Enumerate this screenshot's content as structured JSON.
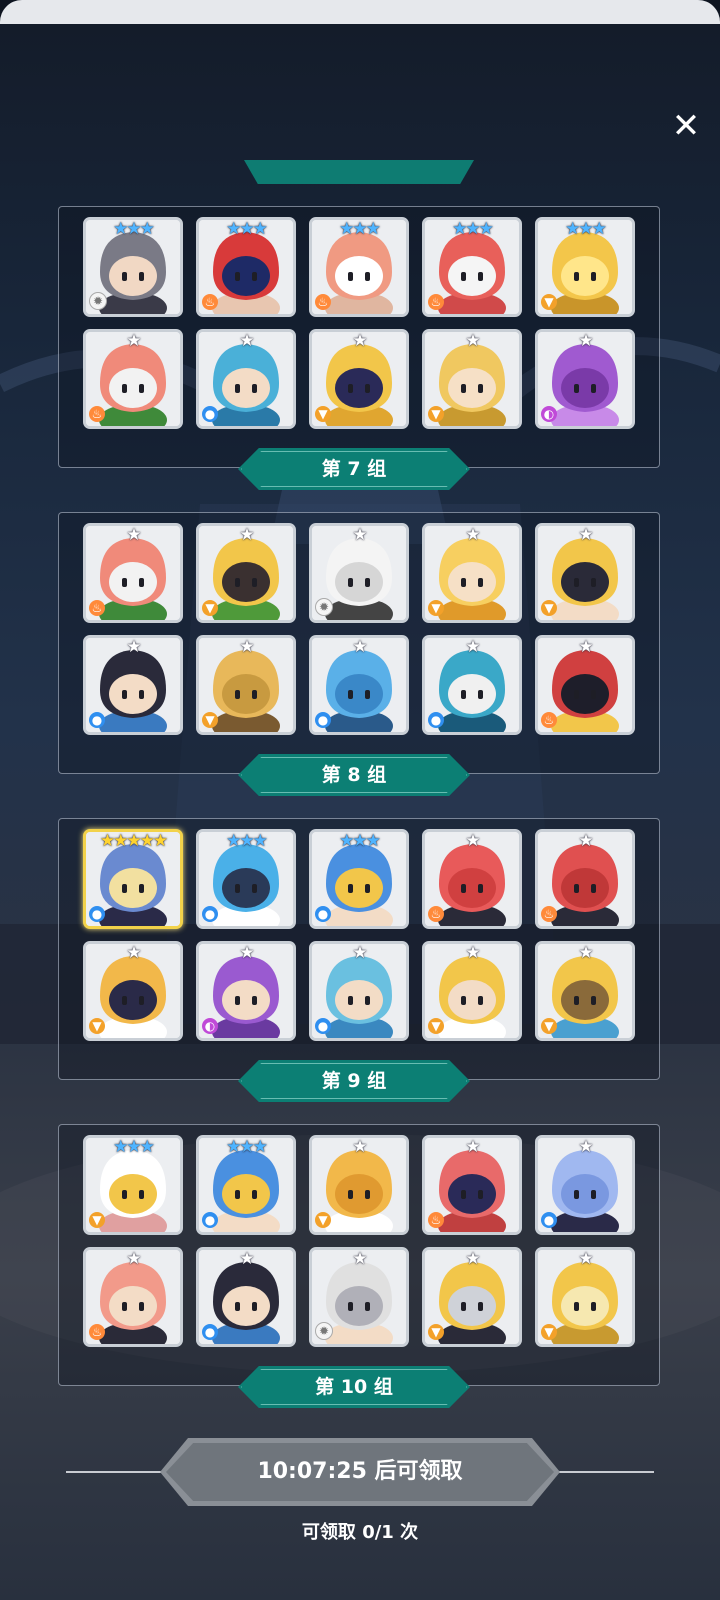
{
  "close_icon": "✕",
  "groups": [
    {
      "label": "第 7 组",
      "cards": [
        {
          "char": "horned-elf-hero",
          "stars": "★★★",
          "star_color": "blue",
          "element": "light",
          "palette": [
            "#7a7a86",
            "#f1d8c4",
            "#3a3a48"
          ]
        },
        {
          "char": "red-hood-rogue",
          "stars": "★★★",
          "star_color": "blue",
          "element": "fire",
          "palette": [
            "#d83a3a",
            "#1e2a66",
            "#e8c6b0"
          ]
        },
        {
          "char": "bearded-sage",
          "stars": "★★★",
          "star_color": "blue",
          "element": "fire",
          "palette": [
            "#f09a82",
            "#ffffff",
            "#e0b6a0"
          ]
        },
        {
          "char": "masked-jester",
          "stars": "★★★",
          "star_color": "blue",
          "element": "fire",
          "palette": [
            "#e8605a",
            "#f5f5f5",
            "#d04a4a"
          ]
        },
        {
          "char": "yellow-beast",
          "stars": "★★★",
          "star_color": "blue",
          "element": "earth",
          "palette": [
            "#f3c64a",
            "#ffe68a",
            "#c9952a"
          ]
        },
        {
          "char": "bandaged-pumpkin",
          "stars": "★",
          "star_color": "white",
          "element": "fire",
          "palette": [
            "#f08a7a",
            "#f2f2f2",
            "#3f8a3a"
          ]
        },
        {
          "char": "blue-hair-girl",
          "stars": "★",
          "star_color": "white",
          "element": "water",
          "palette": [
            "#4ab0d8",
            "#f3dcc6",
            "#2a7aa8"
          ]
        },
        {
          "char": "yellow-skull",
          "stars": "★",
          "star_color": "white",
          "element": "earth",
          "palette": [
            "#f2c64a",
            "#2a2a58",
            "#e0a630"
          ]
        },
        {
          "char": "golden-knight",
          "stars": "★",
          "star_color": "white",
          "element": "earth",
          "palette": [
            "#f0c860",
            "#f6e0c6",
            "#c89a30"
          ]
        },
        {
          "char": "purple-jelly",
          "stars": "★",
          "star_color": "white",
          "element": "dark",
          "palette": [
            "#a05ad0",
            "#7a3aa8",
            "#c88ae8"
          ]
        }
      ]
    },
    {
      "label": "第 8 组",
      "cards": [
        {
          "char": "bandaged-pumpkin",
          "stars": "★",
          "star_color": "white",
          "element": "fire",
          "palette": [
            "#f08a7a",
            "#f2f2f2",
            "#3f8a3a"
          ]
        },
        {
          "char": "sunflower-monster",
          "stars": "★",
          "star_color": "white",
          "element": "earth",
          "palette": [
            "#f2c64a",
            "#3a3030",
            "#4f9a3a"
          ]
        },
        {
          "char": "white-ghost",
          "stars": "★",
          "star_color": "white",
          "element": "light",
          "palette": [
            "#f4f4f4",
            "#d6d6d6",
            "#444444"
          ]
        },
        {
          "char": "fox-girl",
          "stars": "★",
          "star_color": "white",
          "element": "earth",
          "palette": [
            "#f7cf60",
            "#f6e0c6",
            "#e09a2a"
          ]
        },
        {
          "char": "pharaoh-boy",
          "stars": "★",
          "star_color": "white",
          "element": "earth",
          "palette": [
            "#f2c64a",
            "#2a2a38",
            "#f3dcc6"
          ]
        },
        {
          "char": "black-hair-girl",
          "stars": "★",
          "star_color": "white",
          "element": "water",
          "palette": [
            "#2a2a3a",
            "#f3dcc6",
            "#3a7ac0"
          ]
        },
        {
          "char": "stone-totem",
          "stars": "★",
          "star_color": "white",
          "element": "earth",
          "palette": [
            "#e8b85a",
            "#c89a40",
            "#7a5a30"
          ]
        },
        {
          "char": "blue-totem",
          "stars": "★",
          "star_color": "white",
          "element": "water",
          "palette": [
            "#5ab0e8",
            "#3a88c8",
            "#2a5a8a"
          ]
        },
        {
          "char": "horned-spirit",
          "stars": "★",
          "star_color": "white",
          "element": "water",
          "palette": [
            "#3aa8c8",
            "#f0f0f0",
            "#1a5a7a"
          ]
        },
        {
          "char": "red-chest",
          "stars": "★",
          "star_color": "white",
          "element": "fire",
          "palette": [
            "#d04040",
            "#1e1e2a",
            "#f2c64a"
          ]
        }
      ]
    },
    {
      "label": "第 9 组",
      "cards": [
        {
          "char": "blue-paladin",
          "stars": "★★★★★",
          "star_color": "gold",
          "element": "water",
          "gold": true,
          "palette": [
            "#6a8ad0",
            "#f2e0a0",
            "#2a2a48"
          ]
        },
        {
          "char": "blue-dragon",
          "stars": "★★★",
          "star_color": "blue",
          "element": "water",
          "palette": [
            "#4ab0e8",
            "#2a3a58",
            "#ffffff"
          ]
        },
        {
          "char": "crowned-prince",
          "stars": "★★★",
          "star_color": "blue",
          "element": "water",
          "palette": [
            "#4a90e0",
            "#f2c64a",
            "#f3dcc6"
          ]
        },
        {
          "char": "red-puffball",
          "stars": "★",
          "star_color": "white",
          "element": "fire",
          "palette": [
            "#e85a5a",
            "#d04040",
            "#2a2a38"
          ]
        },
        {
          "char": "red-cat-creature",
          "stars": "★",
          "star_color": "white",
          "element": "fire",
          "palette": [
            "#e05050",
            "#c03838",
            "#2a2a38"
          ]
        },
        {
          "char": "cat-mage",
          "stars": "★",
          "star_color": "white",
          "element": "earth",
          "palette": [
            "#f2b84a",
            "#2a2a48",
            "#ffffff"
          ]
        },
        {
          "char": "purple-witch",
          "stars": "★",
          "star_color": "white",
          "element": "dark",
          "palette": [
            "#9a5ad0",
            "#f3dcc6",
            "#6a3aa0"
          ]
        },
        {
          "char": "cat-ear-girl",
          "stars": "★",
          "star_color": "white",
          "element": "water",
          "palette": [
            "#6ac0e0",
            "#f3dcc6",
            "#3a88c0"
          ]
        },
        {
          "char": "winged-blonde",
          "stars": "★",
          "star_color": "white",
          "element": "earth",
          "palette": [
            "#f2c64a",
            "#f3dcc6",
            "#ffffff"
          ]
        },
        {
          "char": "golden-scepter",
          "stars": "★",
          "star_color": "white",
          "element": "earth",
          "palette": [
            "#f2c64a",
            "#8a6a3a",
            "#4aa0d0"
          ]
        }
      ]
    },
    {
      "label": "第 10 组",
      "cards": [
        {
          "char": "white-rabbit",
          "stars": "★★★",
          "star_color": "blue",
          "element": "earth",
          "palette": [
            "#ffffff",
            "#f2c64a",
            "#e0a0a0"
          ]
        },
        {
          "char": "crowned-prince",
          "stars": "★★★",
          "star_color": "blue",
          "element": "water",
          "palette": [
            "#4a90e0",
            "#f2c64a",
            "#f3dcc6"
          ]
        },
        {
          "char": "cactus",
          "stars": "★",
          "star_color": "white",
          "element": "earth",
          "palette": [
            "#f2b84a",
            "#e09a30",
            "#ffffff"
          ]
        },
        {
          "char": "skull-bandit",
          "stars": "★",
          "star_color": "white",
          "element": "fire",
          "palette": [
            "#e86a6a",
            "#2a2a58",
            "#c04040"
          ]
        },
        {
          "char": "blue-ghost",
          "stars": "★",
          "star_color": "white",
          "element": "water",
          "palette": [
            "#a0b8f0",
            "#7a98e0",
            "#2a2a48"
          ]
        },
        {
          "char": "pink-cat-girl",
          "stars": "★",
          "star_color": "white",
          "element": "fire",
          "palette": [
            "#f29a8a",
            "#f3dcc6",
            "#2a2a38"
          ]
        },
        {
          "char": "black-hair-girl",
          "stars": "★",
          "star_color": "white",
          "element": "water",
          "palette": [
            "#2a2a3a",
            "#f3dcc6",
            "#3a7ac0"
          ]
        },
        {
          "char": "silver-knight",
          "stars": "★",
          "star_color": "white",
          "element": "light",
          "palette": [
            "#e0e0e0",
            "#b0b0b8",
            "#f3dcc6"
          ]
        },
        {
          "char": "masked-angel",
          "stars": "★",
          "star_color": "white",
          "element": "earth",
          "palette": [
            "#f2c64a",
            "#cfd2d8",
            "#2a2a38"
          ]
        },
        {
          "char": "horned-sun",
          "stars": "★",
          "star_color": "white",
          "element": "earth",
          "palette": [
            "#f2c64a",
            "#f6e8b0",
            "#c89a30"
          ]
        }
      ]
    }
  ],
  "element_icons": {
    "fire": "♨",
    "water": "●",
    "earth": "▼",
    "light": "✹",
    "dark": "◐"
  },
  "claim": {
    "button_text": "10:07:25 后可领取",
    "count_text": "可领取 0/1 次"
  }
}
